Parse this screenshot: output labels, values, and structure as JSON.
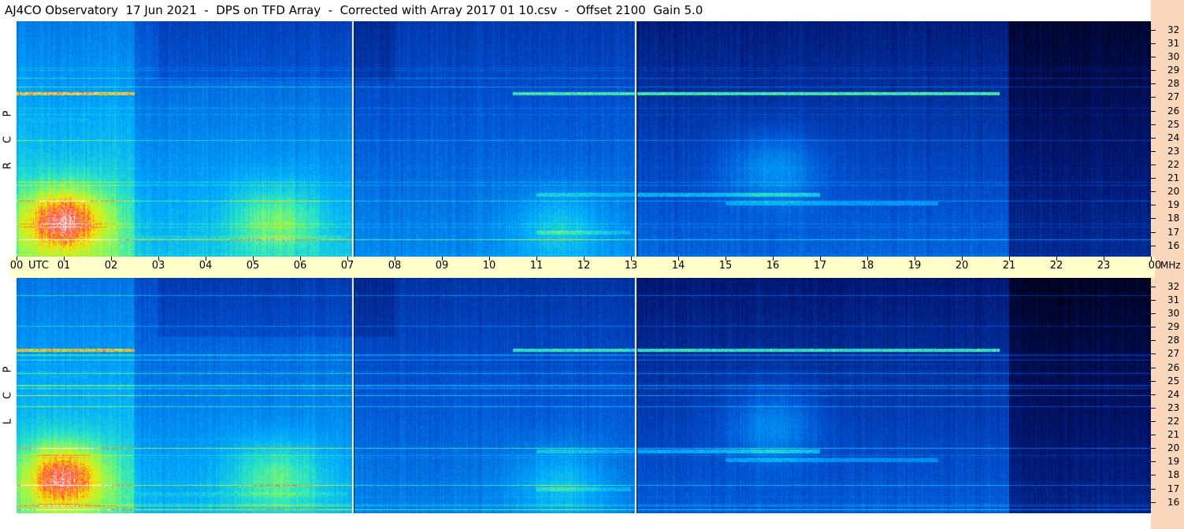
{
  "title": "AJ4CO Observatory  17 Jun 2021  -  DPS on TFD Array  -  Corrected with Array 2017 01 10.csv  -  Offset 2100  Gain 5.0",
  "panels": [
    {
      "polarization": [
        "R",
        "C",
        "P"
      ]
    },
    {
      "polarization": [
        "L",
        "C",
        "P"
      ]
    }
  ],
  "time_axis": {
    "unit_label": "UTC",
    "freq_unit": "MHz",
    "labels": [
      "00",
      "01",
      "02",
      "03",
      "04",
      "05",
      "06",
      "07",
      "08",
      "09",
      "10",
      "11",
      "12",
      "13",
      "14",
      "15",
      "16",
      "17",
      "18",
      "19",
      "20",
      "21",
      "22",
      "23",
      "00"
    ]
  },
  "freq_axis": {
    "labels": [
      "32",
      "31",
      "30",
      "29",
      "28",
      "27",
      "26",
      "25",
      "24",
      "23",
      "22",
      "21",
      "20",
      "19",
      "18",
      "17",
      "16"
    ]
  },
  "colors": {
    "background_strip": "#fad7bb",
    "axis_band": "#ffffcc"
  },
  "chart_data": {
    "type": "heatmap",
    "title": "AJ4CO Observatory  17 Jun 2021  -  DPS on TFD Array  -  Corrected with Array 2017 01 10.csv  -  Offset 2100  Gain 5.0",
    "xlabel": "UTC",
    "ylabel": "MHz",
    "xlim": [
      0,
      24
    ],
    "ylim": [
      16,
      32
    ],
    "panels": [
      "RCP",
      "LCP"
    ],
    "colormap": "black-blue-cyan-green-yellow-red-white",
    "vertical_markers_utc": [
      7.1,
      13.1
    ],
    "features": [
      {
        "type": "band",
        "freq_mhz": 27.1,
        "utc": [
          0,
          2.5
        ],
        "intensity": 0.95
      },
      {
        "type": "band",
        "freq_mhz": 27.1,
        "utc": [
          10.5,
          20.8
        ],
        "intensity": 0.75
      },
      {
        "type": "band",
        "freq_mhz": 25.3,
        "utc": [
          0.2,
          1.5
        ],
        "intensity": 0.6
      },
      {
        "type": "band",
        "freq_mhz": 21.0,
        "utc": [
          0,
          5
        ],
        "intensity": 0.55
      },
      {
        "type": "band",
        "freq_mhz": 20.2,
        "utc": [
          11,
          17
        ],
        "intensity": 0.6
      },
      {
        "type": "band",
        "freq_mhz": 19.6,
        "utc": [
          15,
          19.5
        ],
        "intensity": 0.55
      },
      {
        "type": "band",
        "freq_mhz": 17.6,
        "utc": [
          11,
          13
        ],
        "intensity": 0.6
      },
      {
        "type": "band",
        "freq_mhz": 17.3,
        "utc": [
          0,
          7
        ],
        "intensity": 0.65
      },
      {
        "type": "blob",
        "utc": 1.0,
        "freq_mhz": 18.5,
        "intensity": 0.9
      },
      {
        "type": "blob",
        "utc": 5.5,
        "freq_mhz": 18.5,
        "intensity": 0.55
      },
      {
        "type": "blob",
        "utc": 16.0,
        "freq_mhz": 22,
        "intensity": 0.5
      },
      {
        "type": "blob",
        "utc": 11.5,
        "freq_mhz": 18,
        "intensity": 0.45
      }
    ]
  }
}
